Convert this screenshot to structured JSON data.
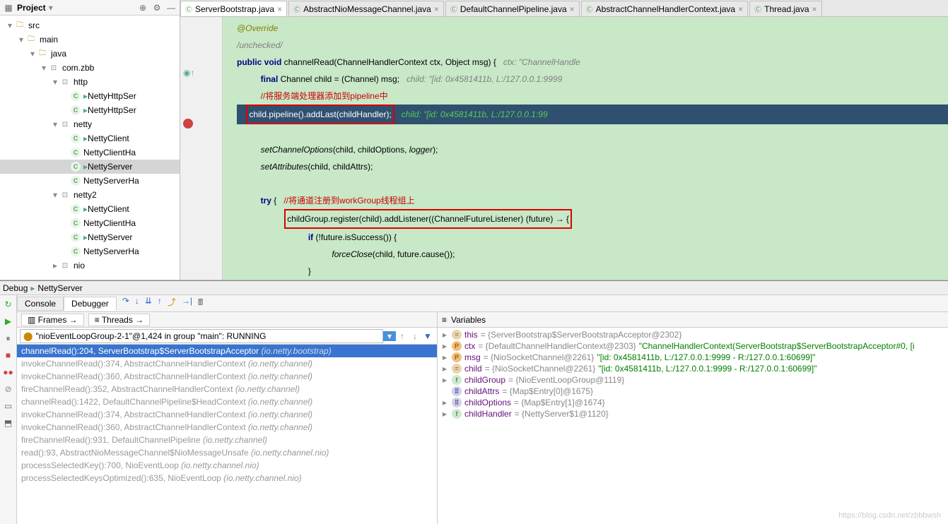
{
  "project": {
    "title": "Project",
    "tree": [
      {
        "depth": 0,
        "arrow": "▾",
        "icon": "folder",
        "label": "src"
      },
      {
        "depth": 1,
        "arrow": "▾",
        "icon": "folder",
        "label": "main"
      },
      {
        "depth": 2,
        "arrow": "▾",
        "icon": "folder",
        "label": "java"
      },
      {
        "depth": 3,
        "arrow": "▾",
        "icon": "pkg",
        "label": "com.zbb"
      },
      {
        "depth": 4,
        "arrow": "▾",
        "icon": "pkg",
        "label": "http"
      },
      {
        "depth": 5,
        "arrow": "",
        "icon": "cls",
        "label": "NettyHttpSer",
        "run": true
      },
      {
        "depth": 5,
        "arrow": "",
        "icon": "cls",
        "label": "NettyHttpSer",
        "run": true
      },
      {
        "depth": 4,
        "arrow": "▾",
        "icon": "pkg",
        "label": "netty"
      },
      {
        "depth": 5,
        "arrow": "",
        "icon": "cls",
        "label": "NettyClient",
        "run": true
      },
      {
        "depth": 5,
        "arrow": "",
        "icon": "cls",
        "label": "NettyClientHa"
      },
      {
        "depth": 5,
        "arrow": "",
        "icon": "cls",
        "label": "NettyServer",
        "run": true,
        "sel": true
      },
      {
        "depth": 5,
        "arrow": "",
        "icon": "cls",
        "label": "NettyServerHa"
      },
      {
        "depth": 4,
        "arrow": "▾",
        "icon": "pkg",
        "label": "netty2"
      },
      {
        "depth": 5,
        "arrow": "",
        "icon": "cls",
        "label": "NettyClient",
        "run": true
      },
      {
        "depth": 5,
        "arrow": "",
        "icon": "cls",
        "label": "NettyClientHa"
      },
      {
        "depth": 5,
        "arrow": "",
        "icon": "cls",
        "label": "NettyServer",
        "run": true
      },
      {
        "depth": 5,
        "arrow": "",
        "icon": "cls",
        "label": "NettyServerHa"
      },
      {
        "depth": 4,
        "arrow": "▸",
        "icon": "pkg",
        "label": "nio"
      }
    ]
  },
  "tabs": [
    {
      "label": "ServerBootstrap.java",
      "active": true
    },
    {
      "label": "AbstractNioMessageChannel.java"
    },
    {
      "label": "DefaultChannelPipeline.java"
    },
    {
      "label": "AbstractChannelHandlerContext.java"
    },
    {
      "label": "Thread.java"
    }
  ],
  "code": {
    "l1_ann": "@Override",
    "l2_cmt": "/unchecked/",
    "l3_a": "public void ",
    "l3_b": "channelRead",
    "l3_c": "(ChannelHandlerContext ctx, Object msg) {",
    "l3_hint": "   ctx: \"ChannelHandle",
    "l4_a": "final ",
    "l4_b": "Channel child = (Channel) msg;",
    "l4_hint": "   child: \"[id: 0x4581411b, L:/127.0.0.1:9999",
    "l5_cmt": "//将服务端处理器添加到pipeline中",
    "l6_box": "child.pipeline().addLast(childHandler);",
    "l6_hint": "   child: \"[id: 0x4581411b, L:/127.0.0.1:99",
    "l8": "setChannelOptions",
    "l8b": "(child, childOptions, ",
    "l8c": "logger",
    "l8d": ");",
    "l9": "setAttributes",
    "l9b": "(child, childAttrs);",
    "l11_a": "try ",
    "l11_b": "{",
    "l11_cmt": "   //将通道注册到workGroup线程组上",
    "l12_box": "childGroup.register(child).addListener((ChannelFutureListener) (future) → {",
    "l13_a": "if ",
    "l13_b": "(!future.isSuccess()) {",
    "l14": "forceClose",
    "l14b": "(child, future.cause());",
    "l15": "}"
  },
  "debug": {
    "title": "Debug",
    "config": "NettyServer",
    "tab_console": "Console",
    "tab_debugger": "Debugger",
    "frames_label": "Frames",
    "threads_label": "Threads",
    "vars_label": "Variables",
    "thread": "\"nioEventLoopGroup-2-1\"@1,424 in group \"main\": RUNNING",
    "frames": [
      {
        "m": "channelRead():204, ServerBootstrap$ServerBootstrapAcceptor",
        "p": "(io.netty.bootstrap)",
        "sel": true
      },
      {
        "m": "invokeChannelRead():374, AbstractChannelHandlerContext",
        "p": "(io.netty.channel)",
        "dim": true
      },
      {
        "m": "invokeChannelRead():360, AbstractChannelHandlerContext",
        "p": "(io.netty.channel)",
        "dim": true
      },
      {
        "m": "fireChannelRead():352, AbstractChannelHandlerContext",
        "p": "(io.netty.channel)",
        "dim": true
      },
      {
        "m": "channelRead():1422, DefaultChannelPipeline$HeadContext",
        "p": "(io.netty.channel)",
        "dim": true
      },
      {
        "m": "invokeChannelRead():374, AbstractChannelHandlerContext",
        "p": "(io.netty.channel)",
        "dim": true
      },
      {
        "m": "invokeChannelRead():360, AbstractChannelHandlerContext",
        "p": "(io.netty.channel)",
        "dim": true
      },
      {
        "m": "fireChannelRead():931, DefaultChannelPipeline",
        "p": "(io.netty.channel)",
        "dim": true
      },
      {
        "m": "read():93, AbstractNioMessageChannel$NioMessageUnsafe",
        "p": "(io.netty.channel.nio)",
        "dim": true
      },
      {
        "m": "processSelectedKey():700, NioEventLoop",
        "p": "(io.netty.channel.nio)",
        "dim": true
      },
      {
        "m": "processSelectedKeysOptimized():635, NioEventLoop",
        "p": "(io.netty.channel.nio)",
        "dim": true
      }
    ],
    "vars": [
      {
        "exp": "▸",
        "ic": "obj",
        "name": "this",
        "val": " = {ServerBootstrap$ServerBootstrapAcceptor@2302}"
      },
      {
        "exp": "▸",
        "ic": "par",
        "name": "ctx",
        "val": " = {DefaultChannelHandlerContext@2303} ",
        "str": "\"ChannelHandlerContext(ServerBootstrap$ServerBootstrapAcceptor#0, [i"
      },
      {
        "exp": "▸",
        "ic": "par",
        "name": "msg",
        "val": " = {NioSocketChannel@2261} ",
        "str": "\"[id: 0x4581411b, L:/127.0.0.1:9999 - R:/127.0.0.1:60699]\""
      },
      {
        "exp": "▸",
        "ic": "obj",
        "name": "child",
        "val": " = {NioSocketChannel@2261} ",
        "str": "\"[id: 0x4581411b, L:/127.0.0.1:9999 - R:/127.0.0.1:60699]\""
      },
      {
        "exp": "▸",
        "ic": "fld",
        "name": "childGroup",
        "val": " = {NioEventLoopGroup@1119}"
      },
      {
        "exp": "",
        "ic": "arr",
        "name": "childAttrs",
        "val": " = {Map$Entry[0]@1675}"
      },
      {
        "exp": "▸",
        "ic": "arr",
        "name": "childOptions",
        "val": " = {Map$Entry[1]@1674}"
      },
      {
        "exp": "▸",
        "ic": "fld",
        "name": "childHandler",
        "val": " = {NettyServer$1@1120}"
      }
    ]
  },
  "watermark": "https://blog.csdn.net/zbbbwsh"
}
